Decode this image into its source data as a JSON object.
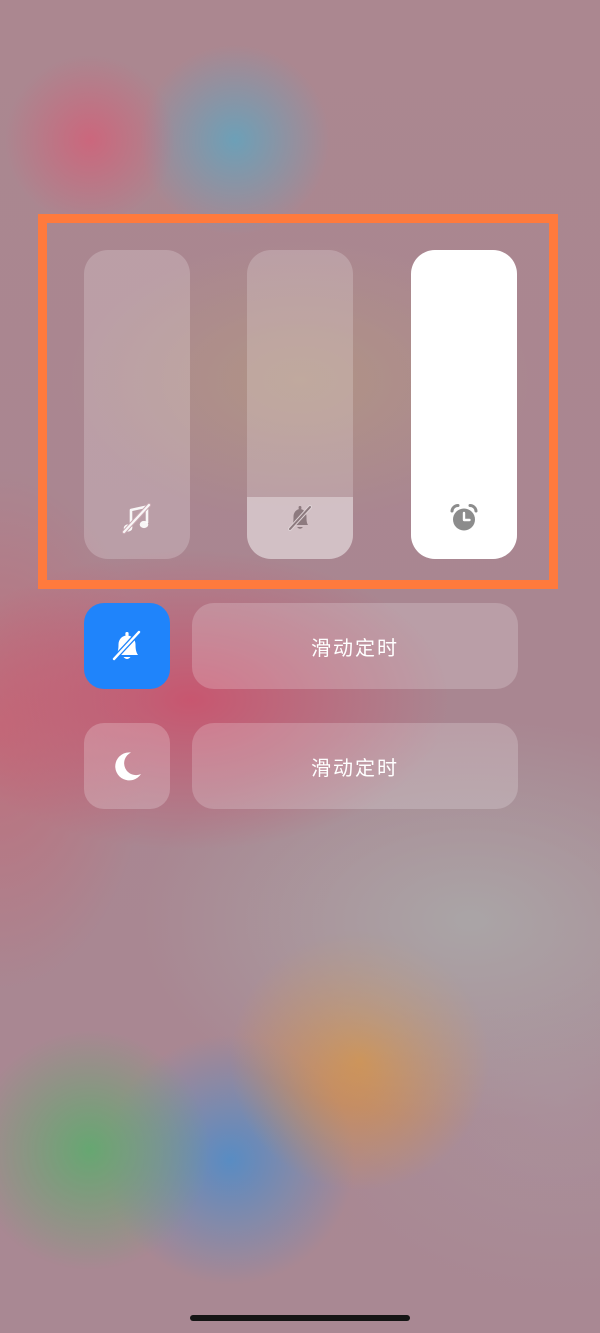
{
  "colors": {
    "highlight_frame": "#ff7a3d",
    "silent_tile_active": "#1f84fb",
    "alarm_slider_fill": "#ffffff"
  },
  "volume_sliders": [
    {
      "id": "media",
      "icon": "music-note-muted-icon",
      "level": 0
    },
    {
      "id": "ringer",
      "icon": "bell-muted-icon",
      "level": 0.2
    },
    {
      "id": "alarm",
      "icon": "alarm-clock-icon",
      "level": 1.0
    }
  ],
  "silent_mode": {
    "icon": "bell-slash-icon",
    "active": true,
    "timer_label": "滑动定时"
  },
  "dnd_mode": {
    "icon": "moon-icon",
    "active": false,
    "timer_label": "滑动定时"
  }
}
